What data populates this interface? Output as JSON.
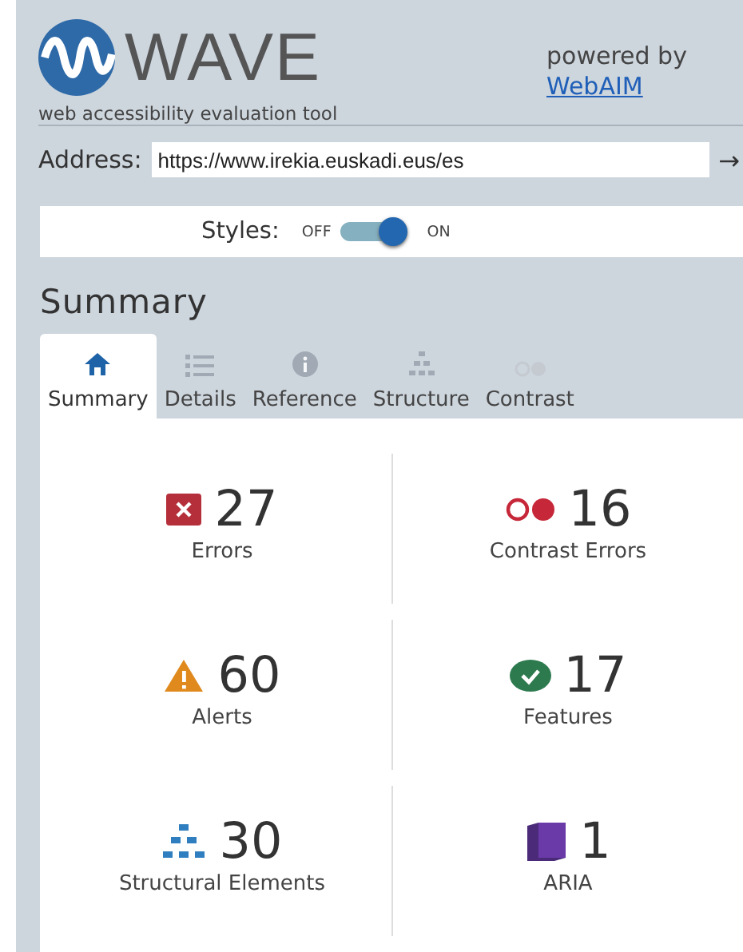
{
  "header": {
    "logo_text": "WAVE",
    "tagline": "web accessibility evaluation tool",
    "powered_by": "powered by",
    "link": "WebAIM"
  },
  "address": {
    "label": "Address:",
    "value": "https://www.irekia.euskadi.eus/es",
    "go": "→"
  },
  "styles": {
    "label": "Styles:",
    "off_label": "OFF",
    "on_label": "ON",
    "on": true
  },
  "section_title": "Summary",
  "tabs": [
    {
      "label": "Summary",
      "kind": "home",
      "selected": true
    },
    {
      "label": "Details",
      "kind": "details",
      "selected": false
    },
    {
      "label": "Reference",
      "kind": "info",
      "selected": false
    },
    {
      "label": "Structure",
      "kind": "structure",
      "selected": false
    },
    {
      "label": "Contrast",
      "kind": "contrast",
      "selected": false
    }
  ],
  "stats": [
    {
      "count": "27",
      "label": "Errors",
      "kind": "error"
    },
    {
      "count": "16",
      "label": "Contrast Errors",
      "kind": "contrast"
    },
    {
      "count": "60",
      "label": "Alerts",
      "kind": "alert"
    },
    {
      "count": "17",
      "label": "Features",
      "kind": "feature"
    },
    {
      "count": "30",
      "label": "Structural Elements",
      "kind": "structure"
    },
    {
      "count": "1",
      "label": "ARIA",
      "kind": "aria"
    }
  ]
}
